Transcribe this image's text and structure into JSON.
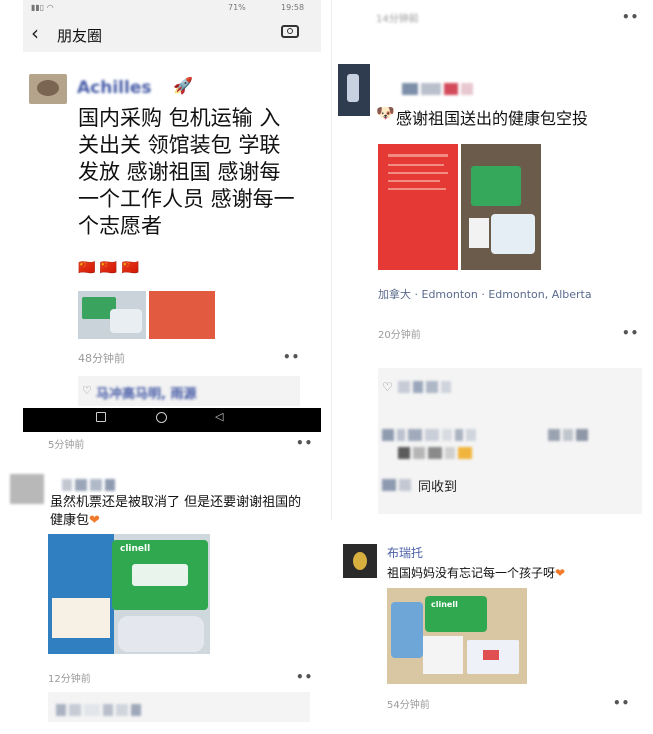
{
  "panel1": {
    "status": {
      "battery": "71%",
      "time": "19:58"
    },
    "header_title": "朋友圈",
    "username": "Achilles",
    "post_text": "国内采购 包机运输 入关出关 领馆装包 学联发放 感谢祖国 感谢每一个工作人员 感谢每一个志愿者",
    "flags": "🇨🇳 🇨🇳 🇨🇳",
    "time": "48分钟前",
    "comment_preview": "马冲高马明, 雨源"
  },
  "panel2": {
    "top_time": "14分钟前",
    "post_text": "感谢祖国送出的健康包空投",
    "location": "加拿大 · Edmonton · Edmonton, Alberta",
    "time": "20分钟前",
    "reply_text": "同收到"
  },
  "panel3": {
    "top_time": "5分钟前",
    "post_text": "虽然机票还是被取消了 但是还要谢谢祖国的健康包",
    "time": "12分钟前",
    "product_brand": "clinell"
  },
  "panel4": {
    "username": "布瑞托",
    "post_text": "祖国妈妈没有忘记每一个孩子呀",
    "time": "54分钟前",
    "product_brand": "clinell"
  }
}
